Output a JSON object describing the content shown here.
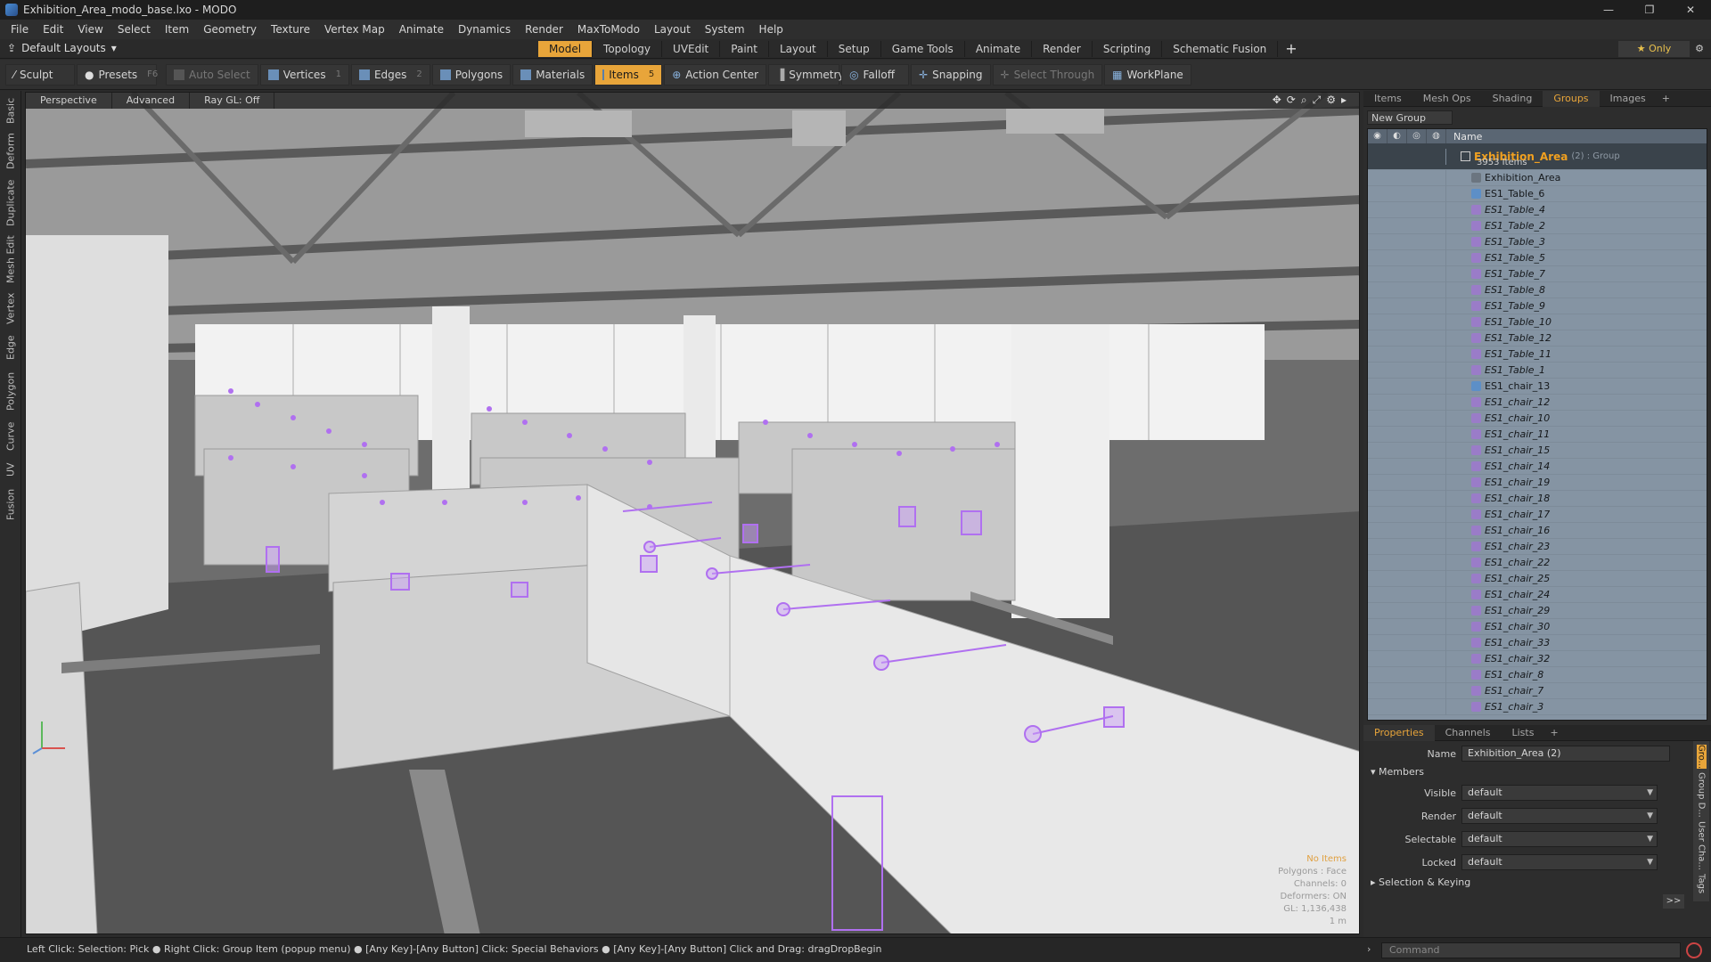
{
  "window": {
    "title": "Exhibition_Area_modo_base.lxo - MODO",
    "buttons": [
      "—",
      "❐",
      "✕"
    ]
  },
  "menu": [
    "File",
    "Edit",
    "View",
    "Select",
    "Item",
    "Geometry",
    "Texture",
    "Vertex Map",
    "Animate",
    "Dynamics",
    "Render",
    "MaxToModo",
    "Layout",
    "System",
    "Help"
  ],
  "layouts_label": "Default Layouts",
  "mode_tabs": [
    {
      "label": "Model",
      "active": true
    },
    {
      "label": "Topology"
    },
    {
      "label": "UVEdit"
    },
    {
      "label": "Paint"
    },
    {
      "label": "Layout"
    },
    {
      "label": "Setup"
    },
    {
      "label": "Game Tools"
    },
    {
      "label": "Animate"
    },
    {
      "label": "Render"
    },
    {
      "label": "Scripting"
    },
    {
      "label": "Schematic Fusion"
    }
  ],
  "only_label": "Only",
  "toolbar": {
    "sculpt": "Sculpt",
    "presets": "Presets",
    "presets_key": "F6",
    "auto_select": "Auto Select",
    "vertices": "Vertices",
    "vertices_key": "1",
    "edges": "Edges",
    "edges_key": "2",
    "polygons": "Polygons",
    "materials": "Materials",
    "items": "Items",
    "items_key": "5",
    "action_center": "Action Center",
    "symmetry": "Symmetry",
    "falloff": "Falloff",
    "snapping": "Snapping",
    "select_through": "Select Through",
    "workplane": "WorkPlane"
  },
  "left_tabs": [
    "Basic",
    "Deform",
    "Duplicate",
    "Mesh Edit",
    "Vertex",
    "Edge",
    "Polygon",
    "Curve",
    "UV",
    "Fusion"
  ],
  "viewport": {
    "view": "Perspective",
    "advanced": "Advanced",
    "raygl": "Ray GL: Off",
    "info": {
      "no_items": "No Items",
      "polygons": "Polygons : Face",
      "channels": "Channels: 0",
      "deformers": "Deformers: ON",
      "gl": "GL: 1,136,438",
      "scale": "1 m"
    }
  },
  "right_tabs": [
    "Items",
    "Mesh Ops",
    "Shading",
    "Groups",
    "Images"
  ],
  "right_tab_active": "Groups",
  "new_group": "New Group",
  "grid_header_name": "Name",
  "group": {
    "name": "Exhibition_Area",
    "meta": "(2) : Group",
    "count": "3953 Items"
  },
  "group_items": [
    {
      "name": "Exhibition_Area",
      "kind": "locator"
    },
    {
      "name": "ES1_Table_6",
      "kind": "mesh"
    },
    {
      "name": "ES1_Table_4",
      "kind": "mesh2"
    },
    {
      "name": "ES1_Table_2",
      "kind": "mesh2"
    },
    {
      "name": "ES1_Table_3",
      "kind": "mesh2"
    },
    {
      "name": "ES1_Table_5",
      "kind": "mesh2"
    },
    {
      "name": "ES1_Table_7",
      "kind": "mesh2"
    },
    {
      "name": "ES1_Table_8",
      "kind": "mesh2"
    },
    {
      "name": "ES1_Table_9",
      "kind": "mesh2"
    },
    {
      "name": "ES1_Table_10",
      "kind": "mesh2"
    },
    {
      "name": "ES1_Table_12",
      "kind": "mesh2"
    },
    {
      "name": "ES1_Table_11",
      "kind": "mesh2"
    },
    {
      "name": "ES1_Table_1",
      "kind": "mesh2"
    },
    {
      "name": "ES1_chair_13",
      "kind": "mesh"
    },
    {
      "name": "ES1_chair_12",
      "kind": "mesh2"
    },
    {
      "name": "ES1_chair_10",
      "kind": "mesh2"
    },
    {
      "name": "ES1_chair_11",
      "kind": "mesh2"
    },
    {
      "name": "ES1_chair_15",
      "kind": "mesh2"
    },
    {
      "name": "ES1_chair_14",
      "kind": "mesh2"
    },
    {
      "name": "ES1_chair_19",
      "kind": "mesh2"
    },
    {
      "name": "ES1_chair_18",
      "kind": "mesh2"
    },
    {
      "name": "ES1_chair_17",
      "kind": "mesh2"
    },
    {
      "name": "ES1_chair_16",
      "kind": "mesh2"
    },
    {
      "name": "ES1_chair_23",
      "kind": "mesh2"
    },
    {
      "name": "ES1_chair_22",
      "kind": "mesh2"
    },
    {
      "name": "ES1_chair_25",
      "kind": "mesh2"
    },
    {
      "name": "ES1_chair_24",
      "kind": "mesh2"
    },
    {
      "name": "ES1_chair_29",
      "kind": "mesh2"
    },
    {
      "name": "ES1_chair_30",
      "kind": "mesh2"
    },
    {
      "name": "ES1_chair_33",
      "kind": "mesh2"
    },
    {
      "name": "ES1_chair_32",
      "kind": "mesh2"
    },
    {
      "name": "ES1_chair_8",
      "kind": "mesh2"
    },
    {
      "name": "ES1_chair_7",
      "kind": "mesh2"
    },
    {
      "name": "ES1_chair_3",
      "kind": "mesh2"
    }
  ],
  "props_tabs": [
    "Properties",
    "Channels",
    "Lists"
  ],
  "props": {
    "name_label": "Name",
    "name_value": "Exhibition_Area (2)",
    "members": "Members",
    "rows": [
      {
        "label": "Visible",
        "value": "default"
      },
      {
        "label": "Render",
        "value": "default"
      },
      {
        "label": "Selectable",
        "value": "default"
      },
      {
        "label": "Locked",
        "value": "default"
      }
    ],
    "sel_keying": "Selection & Keying",
    "more": ">>",
    "side_tabs": [
      "Gro...",
      "Group D...",
      "User Cha...",
      "Tags"
    ]
  },
  "status": {
    "hint": "Left Click: Selection: Pick ● Right Click: Group Item (popup menu) ● [Any Key]-[Any Button] Click: Special Behaviors ● [Any Key]-[Any Button] Click and Drag: dragDropBegin",
    "command_placeholder": "Command"
  },
  "colors": {
    "accent": "#e8a53a",
    "selection": "#b070f0",
    "panel": "#8594a3"
  }
}
